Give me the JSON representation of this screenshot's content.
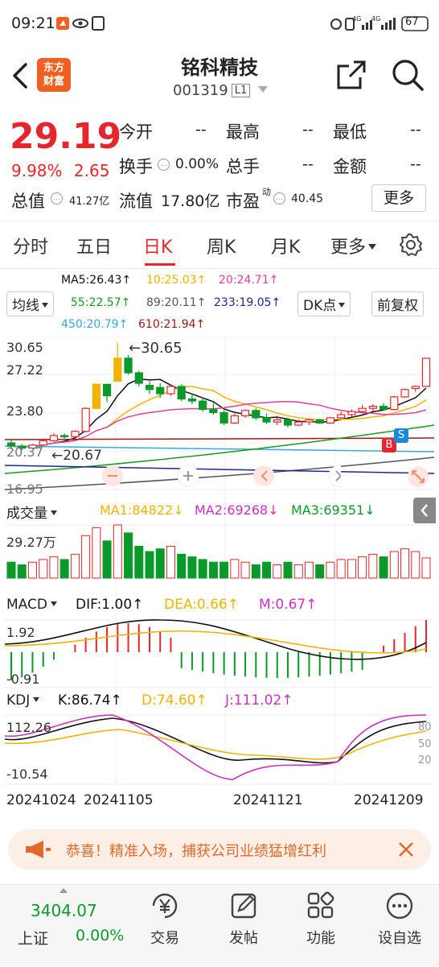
{
  "status_bar": {
    "time": "09:21",
    "net_label": "4G",
    "battery": "67"
  },
  "header": {
    "title": "铭科精技",
    "code": "001319",
    "market_tag": "L1",
    "logo_line1": "东方",
    "logo_line2": "财富"
  },
  "quote": {
    "price": "29.19",
    "change_pct": "9.98%",
    "change": "2.65",
    "open_label": "今开",
    "open_value": "--",
    "high_label": "最高",
    "high_value": "--",
    "low_label": "最低",
    "low_value": "--",
    "turnover_label": "换手",
    "turnover_value": "0.00%",
    "volume_label": "总手",
    "volume_value": "--",
    "amount_label": "金额",
    "amount_value": "--",
    "mktcap_label": "总值",
    "mktcap_value": "41.27亿",
    "float_label": "流值",
    "float_value": "17.80亿",
    "pe_label": "市盈",
    "pe_sup": "动",
    "pe_value": "40.45",
    "more_label": "更多"
  },
  "tabs": [
    {
      "label": "分时"
    },
    {
      "label": "五日"
    },
    {
      "label": "日K"
    },
    {
      "label": "周K"
    },
    {
      "label": "月K"
    },
    {
      "label": "更多"
    }
  ],
  "active_tab": "日K",
  "indicators": {
    "ma_select": "均线",
    "dk_label": "DK点",
    "fq_label": "前复权",
    "ma5": "MA5:26.43↑",
    "ma10": "10:25.03↑",
    "ma20": "20:24.71↑",
    "ma55": "55:22.57↑",
    "ma89": "89:20.11↑",
    "ma233": "233:19.05↑",
    "ma450": "450:20.79↑",
    "ma610": "610:21.94↑"
  },
  "colors": {
    "up": "#e5262d",
    "down": "#0a9a2a",
    "ma5": "#111111",
    "ma10": "#f0b400",
    "ma20": "#e040a0",
    "ma55": "#1a9a1a",
    "ma89": "#555555",
    "ma233": "#1a2a8a",
    "ma450": "#38a8e0",
    "ma610": "#a01818"
  },
  "price_axis": {
    "top": "30.65",
    "mid1": "27.22",
    "mid2": "23.80",
    "low": "20.37",
    "bottom": "16.95",
    "high_mark": "←30.65",
    "low_mark": "←20.67"
  },
  "volume": {
    "select": "成交量",
    "ma1": "MA1:84822↓",
    "ma2": "MA2:69268↓",
    "ma3": "MA3:69351↓",
    "axis_top": "29.27万"
  },
  "macd": {
    "select": "MACD",
    "dif": "DIF:1.00↑",
    "dea": "DEA:0.66↑",
    "m": "M:0.67↑",
    "axis_top": "1.92",
    "axis_bottom": "-0.91"
  },
  "kdj": {
    "select": "KDJ",
    "k": "K:86.74↑",
    "d": "D:74.60↑",
    "j": "J:111.02↑",
    "axis_top": "112.26",
    "axis_bottom": "-10.54",
    "lvl80": "80",
    "lvl50": "50",
    "lvl20": "20"
  },
  "dates": {
    "d1": "20241024",
    "d2": "20241105",
    "d3": "20241121",
    "d4": "20241209"
  },
  "signals": {
    "b": "B",
    "s": "S"
  },
  "banner": {
    "text": "恭喜！精准入场，捕获公司业绩猛增红利"
  },
  "bottom": {
    "index_value": "3404.07",
    "index_name": "上证",
    "index_change": "0.00%",
    "nav": [
      {
        "label": "交易"
      },
      {
        "label": "发帖"
      },
      {
        "label": "功能"
      },
      {
        "label": "设自选"
      }
    ]
  },
  "chart_data": {
    "type": "candlestick",
    "x_range": [
      "20241024",
      "20241209"
    ],
    "y_range": [
      16.95,
      30.65
    ],
    "candles_ohlc": [
      [
        21.1,
        21.5,
        20.5,
        20.8
      ],
      [
        20.8,
        21.0,
        20.4,
        20.6
      ],
      [
        20.6,
        21.0,
        20.5,
        20.9
      ],
      [
        20.9,
        21.4,
        20.8,
        21.3
      ],
      [
        21.3,
        22.0,
        21.2,
        21.8
      ],
      [
        21.8,
        22.0,
        21.5,
        21.7
      ],
      [
        21.7,
        22.3,
        21.6,
        22.2
      ],
      [
        22.2,
        24.5,
        22.1,
        24.4
      ],
      [
        24.4,
        26.8,
        24.3,
        26.7
      ],
      [
        26.7,
        26.7,
        25.0,
        25.6
      ],
      [
        27.0,
        30.65,
        27.0,
        29.2
      ],
      [
        29.2,
        29.5,
        27.6,
        27.8
      ],
      [
        27.8,
        28.0,
        26.5,
        26.8
      ],
      [
        26.6,
        27.0,
        25.8,
        26.2
      ],
      [
        26.4,
        26.8,
        25.4,
        25.8
      ],
      [
        25.8,
        26.7,
        25.6,
        26.5
      ],
      [
        26.5,
        26.7,
        25.1,
        25.3
      ],
      [
        25.3,
        25.8,
        24.8,
        25.1
      ],
      [
        25.1,
        25.4,
        24.1,
        24.3
      ],
      [
        24.3,
        24.9,
        23.8,
        24.0
      ],
      [
        24.0,
        24.2,
        22.8,
        23.0
      ],
      [
        23.0,
        23.9,
        22.9,
        23.7
      ],
      [
        23.7,
        24.3,
        23.5,
        24.2
      ],
      [
        24.2,
        24.4,
        23.3,
        23.5
      ],
      [
        23.5,
        23.9,
        22.9,
        23.1
      ],
      [
        23.1,
        23.7,
        22.8,
        23.3
      ],
      [
        23.3,
        23.5,
        22.6,
        22.8
      ],
      [
        22.8,
        23.3,
        22.7,
        23.1
      ],
      [
        23.1,
        23.4,
        22.8,
        23.3
      ],
      [
        23.3,
        23.4,
        22.9,
        23.0
      ],
      [
        23.0,
        23.6,
        22.9,
        23.5
      ],
      [
        23.5,
        24.1,
        23.4,
        23.8
      ],
      [
        23.8,
        24.3,
        23.6,
        24.1
      ],
      [
        24.1,
        24.7,
        23.9,
        24.4
      ],
      [
        24.4,
        24.8,
        24.1,
        24.6
      ],
      [
        24.6,
        24.9,
        24.2,
        24.3
      ],
      [
        24.3,
        25.6,
        24.2,
        25.5
      ],
      [
        25.5,
        26.3,
        25.4,
        26.2
      ],
      [
        26.3,
        26.6,
        26.0,
        26.5
      ],
      [
        26.5,
        29.19,
        26.5,
        29.19
      ]
    ]
  }
}
